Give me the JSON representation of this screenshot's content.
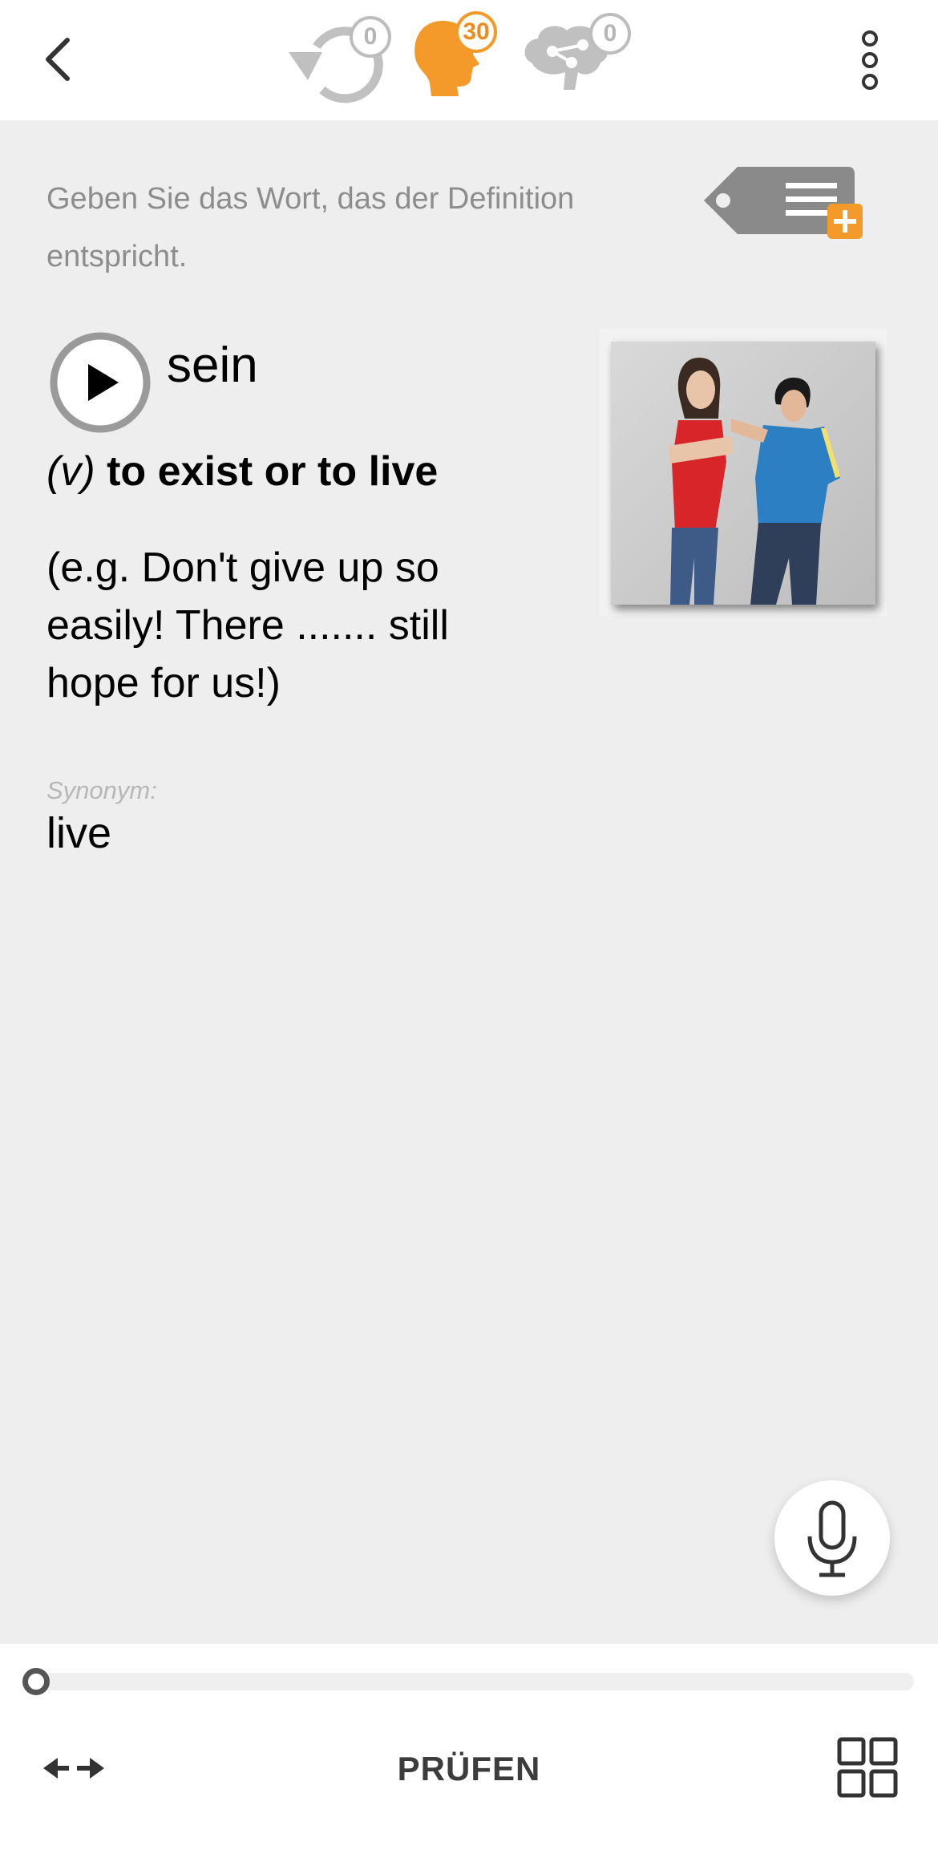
{
  "header": {
    "review_count": "0",
    "learn_count": "30",
    "mindmap_count": "0",
    "colors": {
      "accent": "#f39a2a",
      "inactive": "#bdbdbd"
    },
    "icons": [
      "back-arrow-icon",
      "review-cycle-icon",
      "learning-head-icon",
      "mindmap-brain-icon",
      "more-vertical-icon"
    ]
  },
  "instruction": "Geben Sie das Wort, das der Definition entspricht.",
  "card": {
    "word": "sein",
    "part_of_speech": "(v)",
    "definition": "to exist or to live",
    "example": "(e.g. Don't give up so easily! There ....... still hope for us!)",
    "synonym_label": "Synonym:",
    "synonym": "live"
  },
  "footer": {
    "check_label": "PRÜFEN",
    "progress": 0
  }
}
